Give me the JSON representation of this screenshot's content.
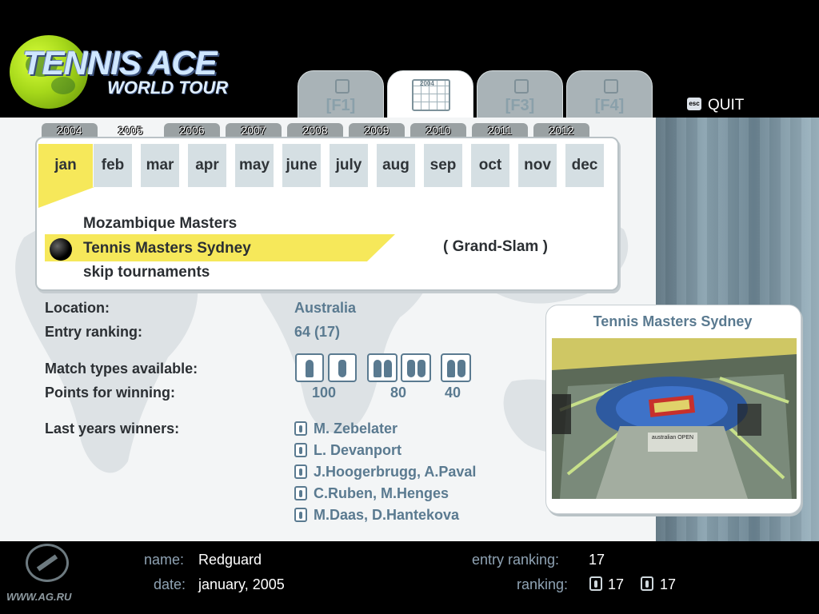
{
  "logo": {
    "title": "TENNIS ACE",
    "subtitle": "WORLD TOUR"
  },
  "tabs": [
    {
      "id": "F1",
      "label": "[F1]",
      "icon": "singles-icon"
    },
    {
      "id": "F2",
      "label": "",
      "icon": "calendar-icon",
      "icon_text": "2004",
      "active": true
    },
    {
      "id": "F3",
      "label": "[F3]",
      "icon": "ranking-icon"
    },
    {
      "id": "F4",
      "label": "[F4]",
      "icon": "options-icon"
    }
  ],
  "quit": {
    "key": "esc",
    "label": "QUIT"
  },
  "years": [
    "2004",
    "2005",
    "2006",
    "2007",
    "2008",
    "2009",
    "2010",
    "2011",
    "2012"
  ],
  "selected_year": "2005",
  "months": [
    "jan",
    "feb",
    "mar",
    "apr",
    "may",
    "june",
    "july",
    "aug",
    "sep",
    "oct",
    "nov",
    "dec"
  ],
  "selected_month": "jan",
  "tournaments": [
    "Mozambique Masters",
    "Tennis Masters Sydney",
    "skip tournaments"
  ],
  "selected_tournament": "Tennis Masters Sydney",
  "tournament_category": "( Grand-Slam )",
  "details": {
    "location_label": "Location:",
    "location": "Australia",
    "entry_ranking_label": "Entry ranking:",
    "entry_ranking": "64 (17)",
    "match_types_label": "Match types available:",
    "points_label": "Points for winning:",
    "points": [
      "100",
      "80",
      "40"
    ],
    "winners_label": "Last years winners:",
    "winners": [
      {
        "type": "men-singles",
        "name": "M. Zebelater"
      },
      {
        "type": "women-singles",
        "name": "L. Devanport"
      },
      {
        "type": "men-doubles",
        "name": "J.Hoogerbrugg, A.Paval"
      },
      {
        "type": "women-doubles",
        "name": "C.Ruben, M.Henges"
      },
      {
        "type": "mixed-doubles",
        "name": "M.Daas, D.Hantekova"
      }
    ]
  },
  "preview": {
    "title": "Tennis Masters Sydney",
    "banner_text": "australian OPEN"
  },
  "player": {
    "name_label": "name:",
    "name": "Redguard",
    "date_label": "date:",
    "date": "january, 2005",
    "entry_ranking_label": "entry ranking:",
    "entry_ranking": "17",
    "ranking_label": "ranking:",
    "ranking_singles": "17",
    "ranking_doubles": "17"
  },
  "watermark": "WWW.AG.RU",
  "colors": {
    "highlight": "#f6e85a",
    "accent": "#5a7a90",
    "panel": "#f3f5f6"
  }
}
